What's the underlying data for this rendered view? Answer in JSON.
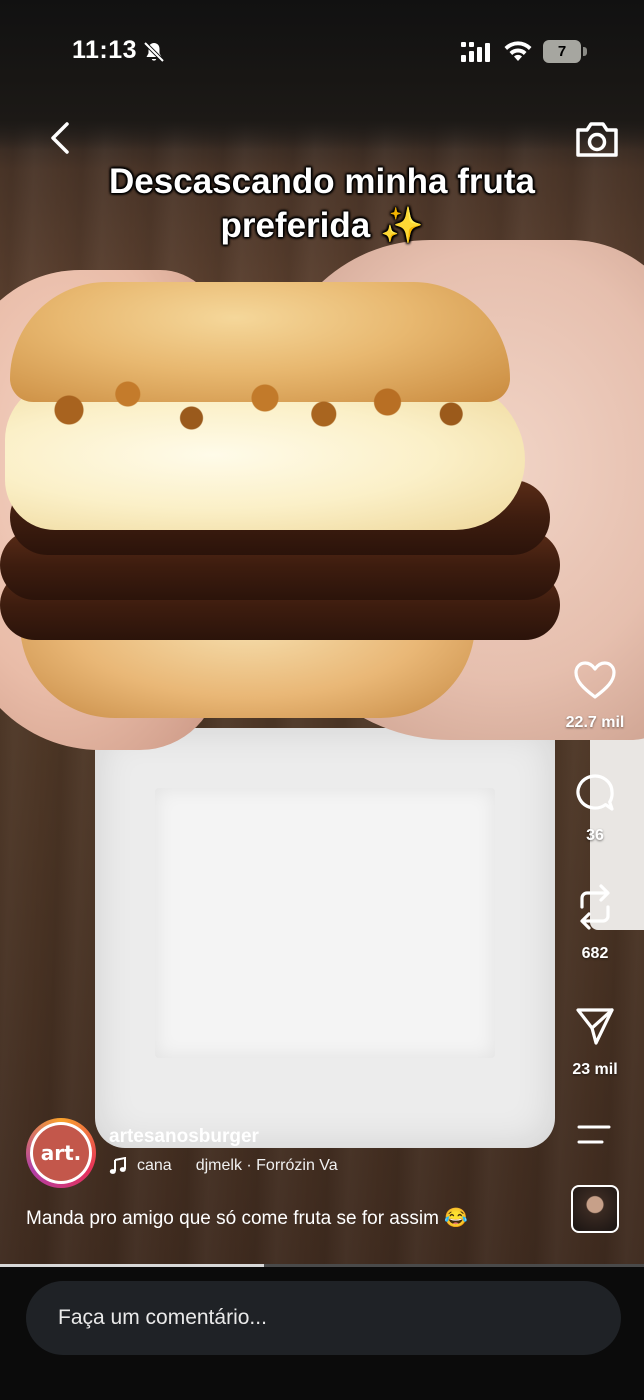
{
  "status_bar": {
    "time": "11:13",
    "battery_level": "7",
    "bell_icon": "bell-slash-icon",
    "signal_icon": "signal-bars-icon",
    "wifi_icon": "wifi-icon"
  },
  "nav": {
    "back_icon": "chevron-left-icon",
    "camera_icon": "camera-icon"
  },
  "video": {
    "caption_line_1": "Descascando minha fruta",
    "caption_line_2": "preferida ✨",
    "progress": 0.41
  },
  "actions": {
    "like_count": "22.7 mil",
    "comment_count": "36",
    "repost_count": "682",
    "share_count": "23 mil"
  },
  "author": {
    "avatar_text": "art.",
    "username": "artesanosburger"
  },
  "audio": {
    "text_a": "cana",
    "text_b": "djmelk · Forrózin Va"
  },
  "post": {
    "caption": "Manda pro amigo que só come fruta se for assim 😂"
  },
  "comment": {
    "placeholder": "Faça um comentário..."
  },
  "colors": {
    "comment_bg": "#1f2226",
    "bottom_bg": "#0b0b0b",
    "avatar_ring": "#e6315a"
  }
}
